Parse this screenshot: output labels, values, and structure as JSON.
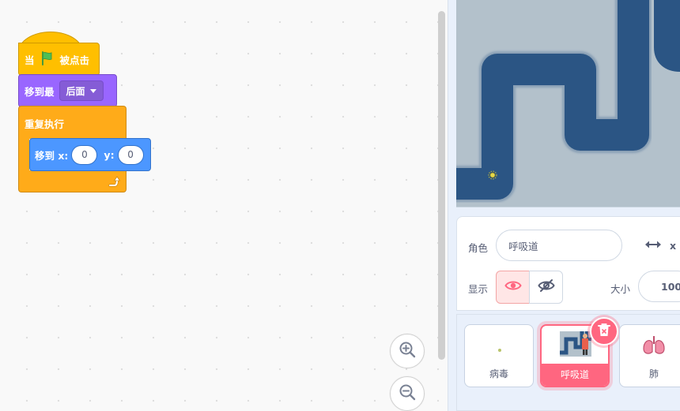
{
  "workspace": {
    "hat_block": {
      "prefix": "当",
      "suffix": "被点击",
      "icon": "green-flag-icon"
    },
    "looks_block": {
      "label": "移到最",
      "dropdown_value": "后面"
    },
    "forever_block": {
      "label": "重复执行",
      "icon": "loop-arrow-icon"
    },
    "motion_block": {
      "label": "移到 x:",
      "x_value": "0",
      "y_label": "y:",
      "y_value": "0"
    },
    "zoom_in_icon": "zoom-in-icon",
    "zoom_out_icon": "zoom-out-icon"
  },
  "sprite_info": {
    "sprite_label": "角色",
    "sprite_name": "呼吸道",
    "x_label": "x",
    "show_label": "显示",
    "size_label": "大小",
    "size_value": "100"
  },
  "sprites": [
    {
      "name": "病毒",
      "selected": false
    },
    {
      "name": "呼吸道",
      "selected": true
    },
    {
      "name": "肺",
      "selected": false
    }
  ],
  "colors": {
    "events": "#ffbf00",
    "looks": "#9966ff",
    "control": "#ffab19",
    "motion": "#4c97ff",
    "selected": "#ff6680",
    "stage_bg": "#b3c1cb",
    "path": "#2b5584"
  }
}
